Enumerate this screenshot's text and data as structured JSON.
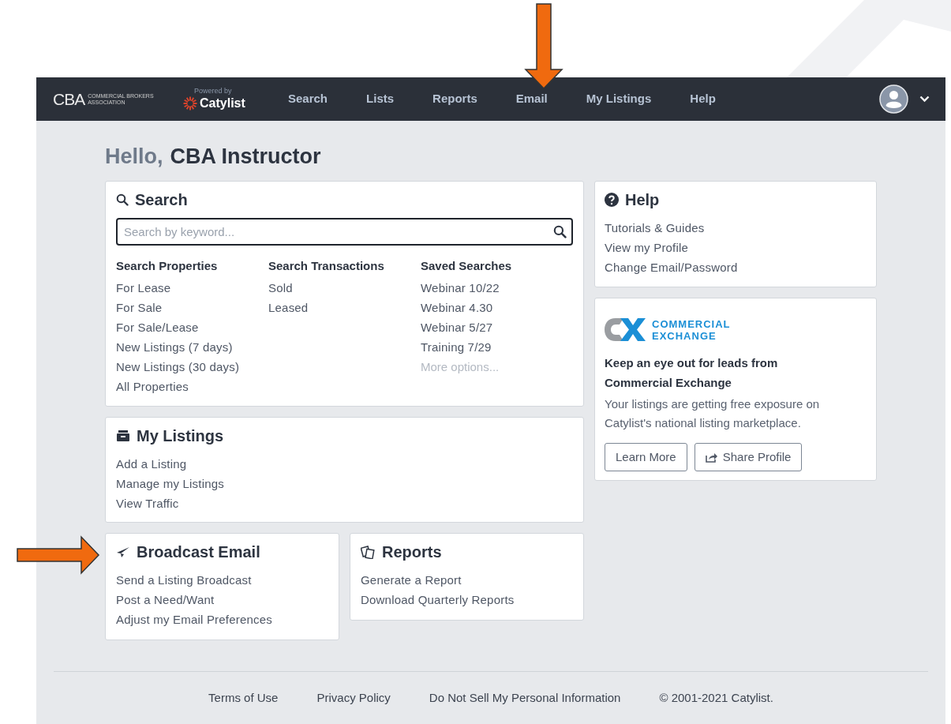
{
  "annotations": [
    {
      "kind": "arrow-down"
    },
    {
      "kind": "arrow-right"
    }
  ],
  "header": {
    "brand": {
      "mark": "CBA",
      "name_lines": [
        "COMMERCIAL BROKERS",
        "ASSOCIATION"
      ]
    },
    "powered_by": "Powered by",
    "platform": "Catylist",
    "nav": [
      {
        "label": "Search"
      },
      {
        "label": "Lists"
      },
      {
        "label": "Reports"
      },
      {
        "label": "Email"
      },
      {
        "label": "My Listings"
      },
      {
        "label": "Help"
      }
    ]
  },
  "greeting": {
    "prefix": "Hello,",
    "name": "CBA Instructor"
  },
  "search_card": {
    "title": "Search",
    "placeholder": "Search by keyword...",
    "columns": [
      {
        "heading": "Search Properties",
        "links": [
          "For Lease",
          "For Sale",
          "For Sale/Lease",
          "New Listings (7 days)",
          "New Listings (30 days)",
          "All Properties"
        ]
      },
      {
        "heading": "Search Transactions",
        "links": [
          "Sold",
          "Leased"
        ]
      },
      {
        "heading": "Saved Searches",
        "links": [
          "Webinar 10/22",
          "Webinar 4.30",
          "Webinar 5/27",
          "Training 7/29"
        ],
        "more": "More options..."
      }
    ]
  },
  "my_listings": {
    "title": "My Listings",
    "links": [
      "Add a Listing",
      "Manage my Listings",
      "View Traffic"
    ]
  },
  "broadcast": {
    "title": "Broadcast Email",
    "links": [
      "Send a Listing Broadcast",
      "Post a Need/Want",
      "Adjust my Email Preferences"
    ]
  },
  "reports": {
    "title": "Reports",
    "links": [
      "Generate a Report",
      "Download Quarterly Reports"
    ]
  },
  "help": {
    "title": "Help",
    "links": [
      "Tutorials & Guides",
      "View my Profile",
      "Change Email/Password"
    ]
  },
  "cx_card": {
    "logo_lines": [
      "COMMERCIAL",
      "EXCHANGE"
    ],
    "headline_lines": [
      "Keep an eye out for leads from",
      "Commercial Exchange"
    ],
    "body": "Your listings are getting free exposure on Catylist's national listing marketplace.",
    "buttons": [
      {
        "label": "Learn More",
        "kind": "plain"
      },
      {
        "label": "Share Profile",
        "kind": "share"
      }
    ]
  },
  "footer": {
    "links": [
      "Terms of Use",
      "Privacy Policy",
      "Do Not Sell My Personal Information"
    ],
    "copyright": "© 2001-2021 Catylist."
  }
}
